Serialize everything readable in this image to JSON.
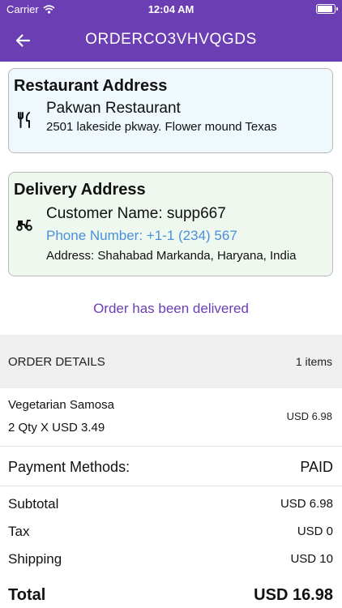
{
  "status_bar": {
    "carrier": "Carrier",
    "time": "12:04 AM",
    "wifi_icon": "wifi-icon",
    "battery_icon": "battery-icon"
  },
  "header": {
    "title": "ORDERCO3VHVQGDS",
    "back_icon": "arrow-left-icon"
  },
  "restaurant": {
    "heading": "Restaurant Address",
    "icon": "fork-knife-icon",
    "name": "Pakwan Restaurant",
    "address": "2501 lakeside pkway. Flower mound Texas"
  },
  "delivery": {
    "heading": "Delivery Address",
    "icon": "scooter-icon",
    "customer": "Customer Name: supp667",
    "phone": "Phone Number: +1-1 (234) 567",
    "address": "Address: Shahabad Markanda, Haryana, India"
  },
  "order_status": "Order has been delivered",
  "order_details": {
    "label": "ORDER DETAILS",
    "count": "1 items",
    "items": [
      {
        "name": "Vegetarian Samosa",
        "qty": "2 Qty X USD 3.49",
        "price": "USD 6.98"
      }
    ]
  },
  "summary": {
    "payment_label": "Payment Methods:",
    "payment_value": "PAID",
    "subtotal_label": "Subtotal",
    "subtotal_value": "USD 6.98",
    "tax_label": "Tax",
    "tax_value": "USD 0",
    "shipping_label": "Shipping",
    "shipping_value": "USD 10",
    "total_label": "Total",
    "total_value": "USD 16.98"
  },
  "colors": {
    "primary": "#6b3fb3",
    "phone_link": "#4a90d9",
    "restaurant_card_bg": "#eef8fd",
    "delivery_card_bg": "#eef8ee"
  }
}
